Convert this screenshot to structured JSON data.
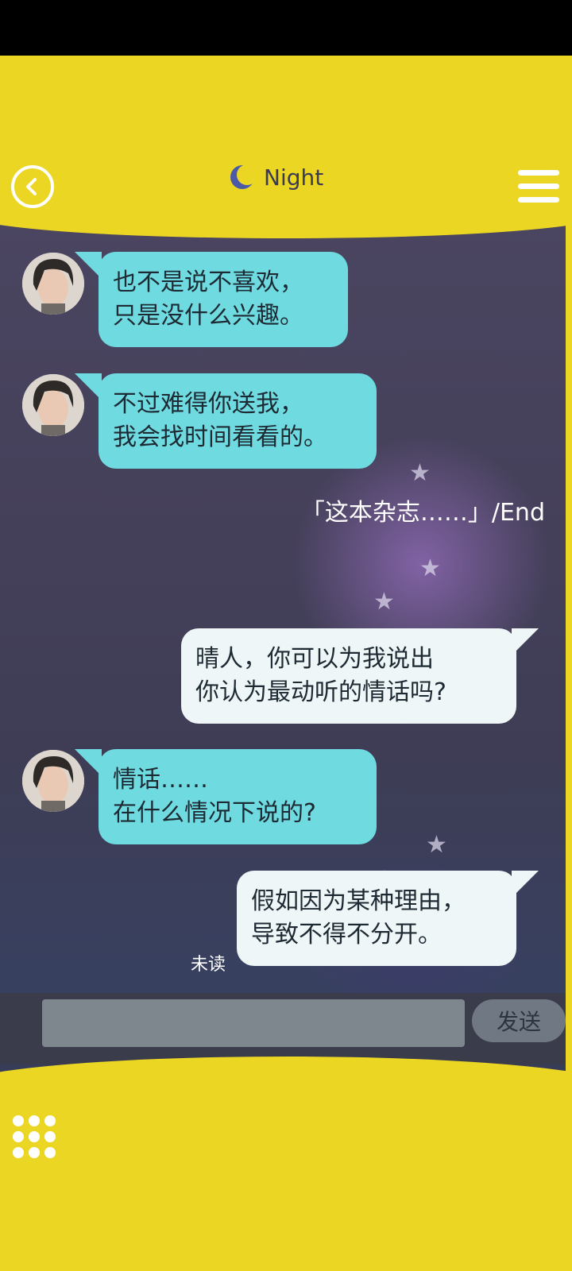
{
  "header": {
    "title": "Night",
    "icons": {
      "back": "back-arrow-icon",
      "moon": "moon-icon",
      "menu": "hamburger-menu-icon"
    }
  },
  "messages": [
    {
      "side": "left",
      "text": "也不是说不喜欢，\n只是没什么兴趣。"
    },
    {
      "side": "left",
      "text": "不过难得你送我，\n我会找时间看看的。"
    },
    {
      "side": "narration",
      "text": "「这本杂志……」/End"
    },
    {
      "side": "right",
      "text": "晴人，你可以为我说出\n你认为最动听的情话吗?"
    },
    {
      "side": "left",
      "text": "情话……\n在什么情况下说的?"
    },
    {
      "side": "right",
      "text": "假如因为某种理由，\n导致不得不分开。",
      "status": "未读"
    }
  ],
  "input": {
    "value": "",
    "send_label": "发送"
  },
  "footer": {
    "icon": "grid-menu-icon"
  },
  "colors": {
    "accent": "#ecd624",
    "left_bubble": "#6fdbe1",
    "right_bubble": "#eef6f7"
  }
}
